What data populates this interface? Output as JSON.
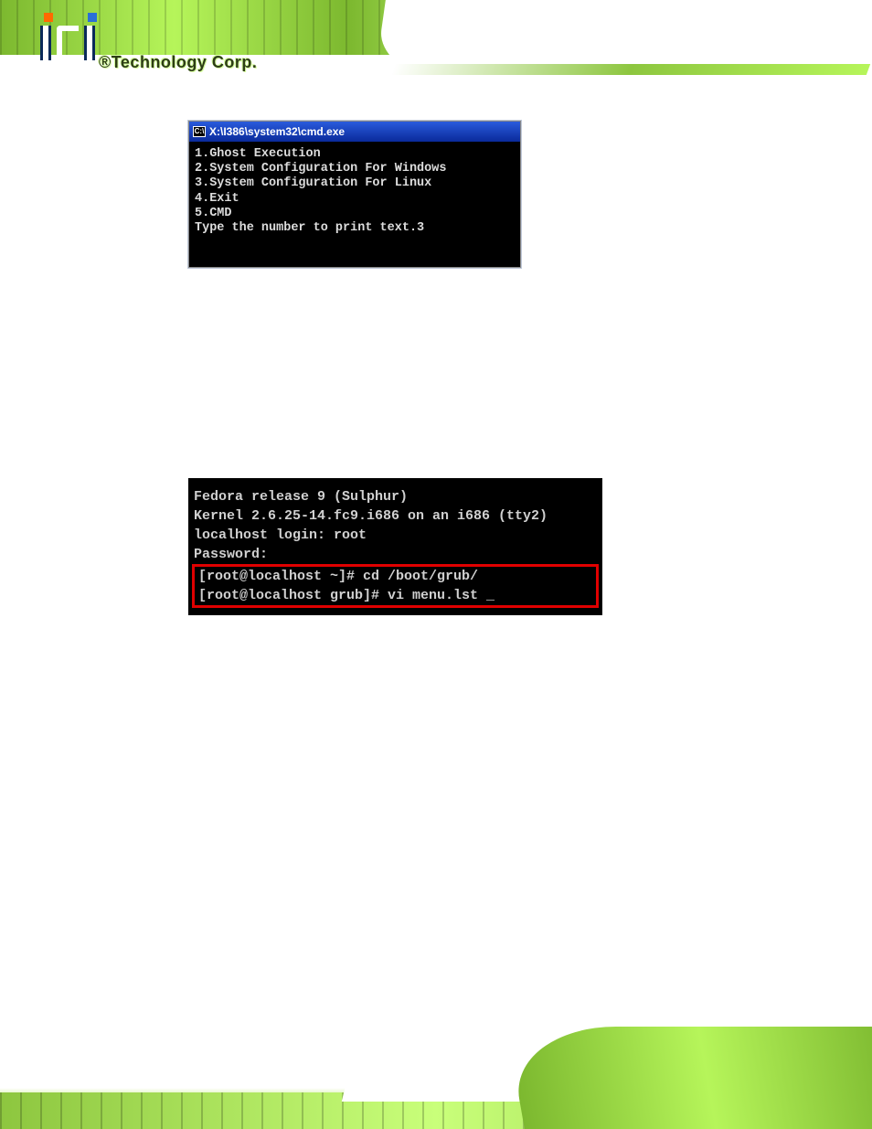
{
  "header": {
    "logo_text": "iEi",
    "tagline": "®Technology Corp."
  },
  "cmd_window": {
    "title_icon_text": "C:\\",
    "title": "X:\\I386\\system32\\cmd.exe",
    "lines": [
      "1.Ghost Execution",
      "2.System Configuration For Windows",
      "3.System Configuration For Linux",
      "4.Exit",
      "5.CMD",
      "Type the number to print text.3"
    ]
  },
  "linux_terminal": {
    "lines_top": [
      "Fedora release 9 (Sulphur)",
      "Kernel 2.6.25-14.fc9.i686 on an i686 (tty2)",
      "",
      "localhost login: root",
      "Password:"
    ],
    "lines_highlight": [
      "[root@localhost ~]# cd /boot/grub/",
      "[root@localhost grub]# vi menu.lst _"
    ]
  }
}
